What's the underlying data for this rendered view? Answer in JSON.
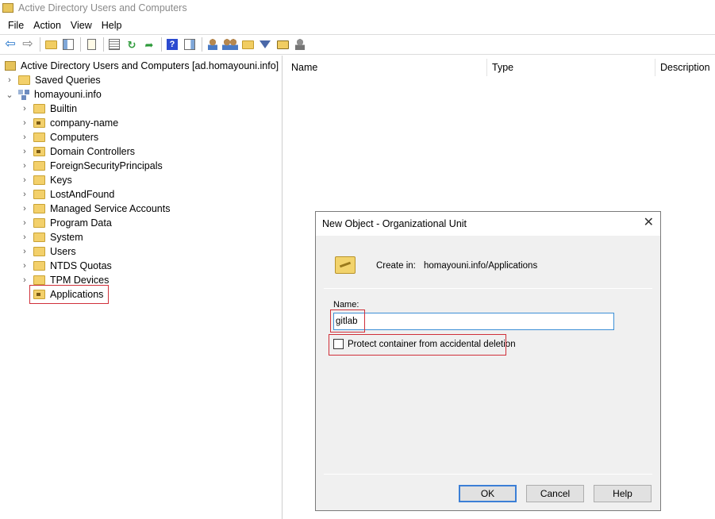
{
  "window": {
    "title": "Active Directory Users and Computers"
  },
  "menu": [
    "File",
    "Action",
    "View",
    "Help"
  ],
  "toolbar": {
    "icons": [
      "back-arrow-icon",
      "forward-arrow-icon",
      "up-folder-icon",
      "show-console-tree-icon",
      "properties-icon",
      "export-list-icon",
      "refresh-icon",
      "export-icon",
      "help-icon",
      "action-pane-icon",
      "new-user-icon",
      "new-group-icon",
      "new-ou-icon",
      "filter-icon",
      "find-icon",
      "delegate-icon"
    ]
  },
  "tree": {
    "root_label": "Active Directory Users and Computers [ad.homayouni.info]",
    "saved_queries": "Saved Queries",
    "domain": "homayouni.info",
    "items": [
      {
        "label": "Builtin",
        "type": "container"
      },
      {
        "label": "company-name",
        "type": "ou"
      },
      {
        "label": "Computers",
        "type": "container"
      },
      {
        "label": "Domain Controllers",
        "type": "ou"
      },
      {
        "label": "ForeignSecurityPrincipals",
        "type": "container"
      },
      {
        "label": "Keys",
        "type": "container"
      },
      {
        "label": "LostAndFound",
        "type": "container"
      },
      {
        "label": "Managed Service Accounts",
        "type": "container"
      },
      {
        "label": "Program Data",
        "type": "container"
      },
      {
        "label": "System",
        "type": "container"
      },
      {
        "label": "Users",
        "type": "container"
      },
      {
        "label": "NTDS Quotas",
        "type": "container"
      },
      {
        "label": "TPM Devices",
        "type": "container"
      }
    ],
    "selected": "Applications"
  },
  "list": {
    "columns": [
      "Name",
      "Type",
      "Description"
    ]
  },
  "dialog": {
    "title": "New Object - Organizational Unit",
    "create_in_label": "Create in:",
    "create_in_value": "homayouni.info/Applications",
    "name_label": "Name:",
    "name_value": "gitlab",
    "protect_label": "Protect container from accidental deletion",
    "protect_checked": false,
    "ok": "OK",
    "cancel": "Cancel",
    "help": "Help"
  },
  "colors": {
    "highlight": "#d0303a",
    "focus": "#3c8fd6"
  }
}
